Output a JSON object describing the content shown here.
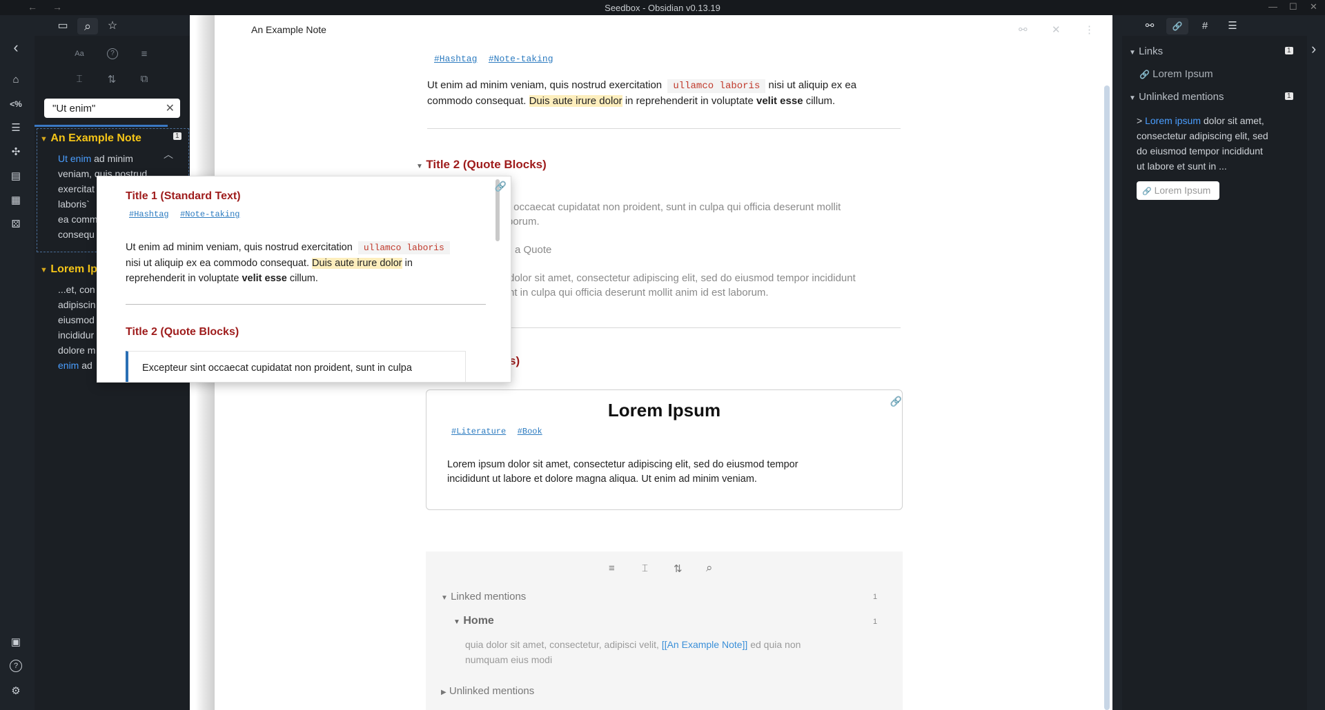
{
  "window": {
    "title": "Seedbox - Obsidian v0.13.19",
    "back_glyph": "←",
    "forward_glyph": "→",
    "minimize_glyph": "—",
    "maximize_glyph": "☐",
    "close_glyph": "✕"
  },
  "ribbon": {
    "collapse_glyph": "‹",
    "items": [
      {
        "icon": "home-icon",
        "glyph": "⌂"
      },
      {
        "icon": "percent-code-icon",
        "glyph": "<%"
      },
      {
        "icon": "document-list-icon",
        "glyph": "☰"
      },
      {
        "icon": "graph-icon",
        "glyph": "✣"
      },
      {
        "icon": "slides-icon",
        "glyph": "▤"
      },
      {
        "icon": "dashboard-icon",
        "glyph": "▦"
      },
      {
        "icon": "dice-icon",
        "glyph": "⚄"
      }
    ],
    "bottom": [
      {
        "icon": "vault-icon",
        "glyph": "▣"
      },
      {
        "icon": "help-icon",
        "glyph": "?"
      },
      {
        "icon": "settings-icon",
        "glyph": "⚙"
      }
    ]
  },
  "left_panel": {
    "tabs": [
      {
        "icon": "folder-icon",
        "glyph": "▭"
      },
      {
        "icon": "search-icon",
        "glyph": "⌕"
      },
      {
        "icon": "star-icon",
        "glyph": "☆"
      }
    ],
    "tools_row1": [
      {
        "icon": "match-case-icon",
        "glyph": "Aa"
      },
      {
        "icon": "explain-query-icon",
        "glyph": "?"
      },
      {
        "icon": "list-icon",
        "glyph": "≡"
      }
    ],
    "tools_row2": [
      {
        "icon": "collapse-results-icon",
        "glyph": "⌶"
      },
      {
        "icon": "sort-icon",
        "glyph": "⇅"
      },
      {
        "icon": "copy-results-icon",
        "glyph": "⧉"
      }
    ],
    "search_value": "\"Ut enim\"",
    "clear_glyph": "✕",
    "results": [
      {
        "title": "An Example Note",
        "count": "1",
        "lines": [
          "ad minim",
          "veniam, quis nostrud",
          "exercitat",
          "laboris`",
          "ea comm",
          "consequ"
        ],
        "match": "Ut enim"
      },
      {
        "title": "Lorem Ip",
        "lines": [
          "...et, con",
          "adipiscin",
          "eiusmod",
          "incididur",
          "dolore m"
        ],
        "last_match": "enim",
        "last_rest": " ad"
      }
    ]
  },
  "editor": {
    "tab_title": "An Example Note",
    "tags": [
      "#Hashtag",
      "#Note-taking"
    ],
    "para1_a": "Ut enim ad minim veniam, quis nostrud exercitation",
    "para1_code": "ullamco laboris",
    "para1_b": "nisi ut aliquip ex ea",
    "para1_c": "commodo consequat.",
    "para1_hl": "Duis aute irure dolor",
    "para1_d": "in reprehenderit in voluptate",
    "para1_bold": "velit esse",
    "para1_e": "cillum.",
    "title2": "Title 2 (Quote Blocks)",
    "quote1_a": "r occaecat cupidatat non proident, sunt in culpa qui officia deserunt mollit",
    "quote1_b": "borum.",
    "quote_label": "a Quote",
    "quote2_a": "dolor sit amet, consectetur adipiscing elit, sed do eiusmod tempor incididunt",
    "quote2_b": "nt in culpa qui officia deserunt mollit anim id est laborum.",
    "title3_fragment": "s)",
    "card": {
      "title": "Lorem Ipsum",
      "tags": [
        "#Literature",
        "#Book"
      ],
      "text_a": "Lorem ipsum dolor sit amet, consectetur adipiscing elit, sed do eiusmod tempor",
      "text_b": "incididunt ut labore et dolore magna aliqua. Ut enim ad minim veniam."
    },
    "backlinks": {
      "tool_icons": [
        {
          "icon": "list-icon",
          "glyph": "≡"
        },
        {
          "icon": "collapse-icon",
          "glyph": "⌶"
        },
        {
          "icon": "sort-icon",
          "glyph": "⇅"
        },
        {
          "icon": "search-icon",
          "glyph": "⌕"
        }
      ],
      "linked_label": "Linked mentions",
      "linked_count": "1",
      "home_label": "Home",
      "home_count": "1",
      "home_text_a": "quia dolor sit amet, consectetur, adipisci velit,",
      "home_link": "[[An Example Note]]",
      "home_text_b": "ed quia non",
      "home_text_c": "numquam eius modi",
      "unlinked_label": "Unlinked mentions"
    }
  },
  "popover": {
    "title1": "Title 1 (Standard Text)",
    "tags": [
      "#Hashtag",
      "#Note-taking"
    ],
    "p_a": "Ut enim ad minim veniam, quis nostrud exercitation",
    "p_code": "ullamco laboris",
    "p_b": "nisi ut aliquip ex ea commodo consequat.",
    "p_hl": "Duis aute irure dolor",
    "p_c": "in",
    "p_d": "reprehenderit in voluptate",
    "p_bold": "velit esse",
    "p_e": "cillum.",
    "title2": "Title 2 (Quote Blocks)",
    "quote": "Excepteur sint occaecat cupidatat non proident, sunt in culpa"
  },
  "right_panel": {
    "tabs": [
      {
        "icon": "backlinks-icon",
        "glyph": "⚯"
      },
      {
        "icon": "outgoing-links-icon",
        "glyph": "🔗"
      },
      {
        "icon": "tags-icon",
        "glyph": "#"
      },
      {
        "icon": "outline-icon",
        "glyph": "☰"
      }
    ],
    "links_label": "Links",
    "links_count": "1",
    "link_item": "Lorem Ipsum",
    "unlinked_label": "Unlinked mentions",
    "unlinked_count": "1",
    "mention_arrow": ">",
    "mention_link": "Lorem ipsum",
    "mention_a": " dolor sit amet,",
    "mention_b": "consectetur adipiscing elit, sed",
    "mention_c": "do eiusmod tempor incididunt",
    "mention_d": "ut labore et sunt in ...",
    "link_button": "Lorem Ipsum",
    "expand_glyph": "›"
  }
}
